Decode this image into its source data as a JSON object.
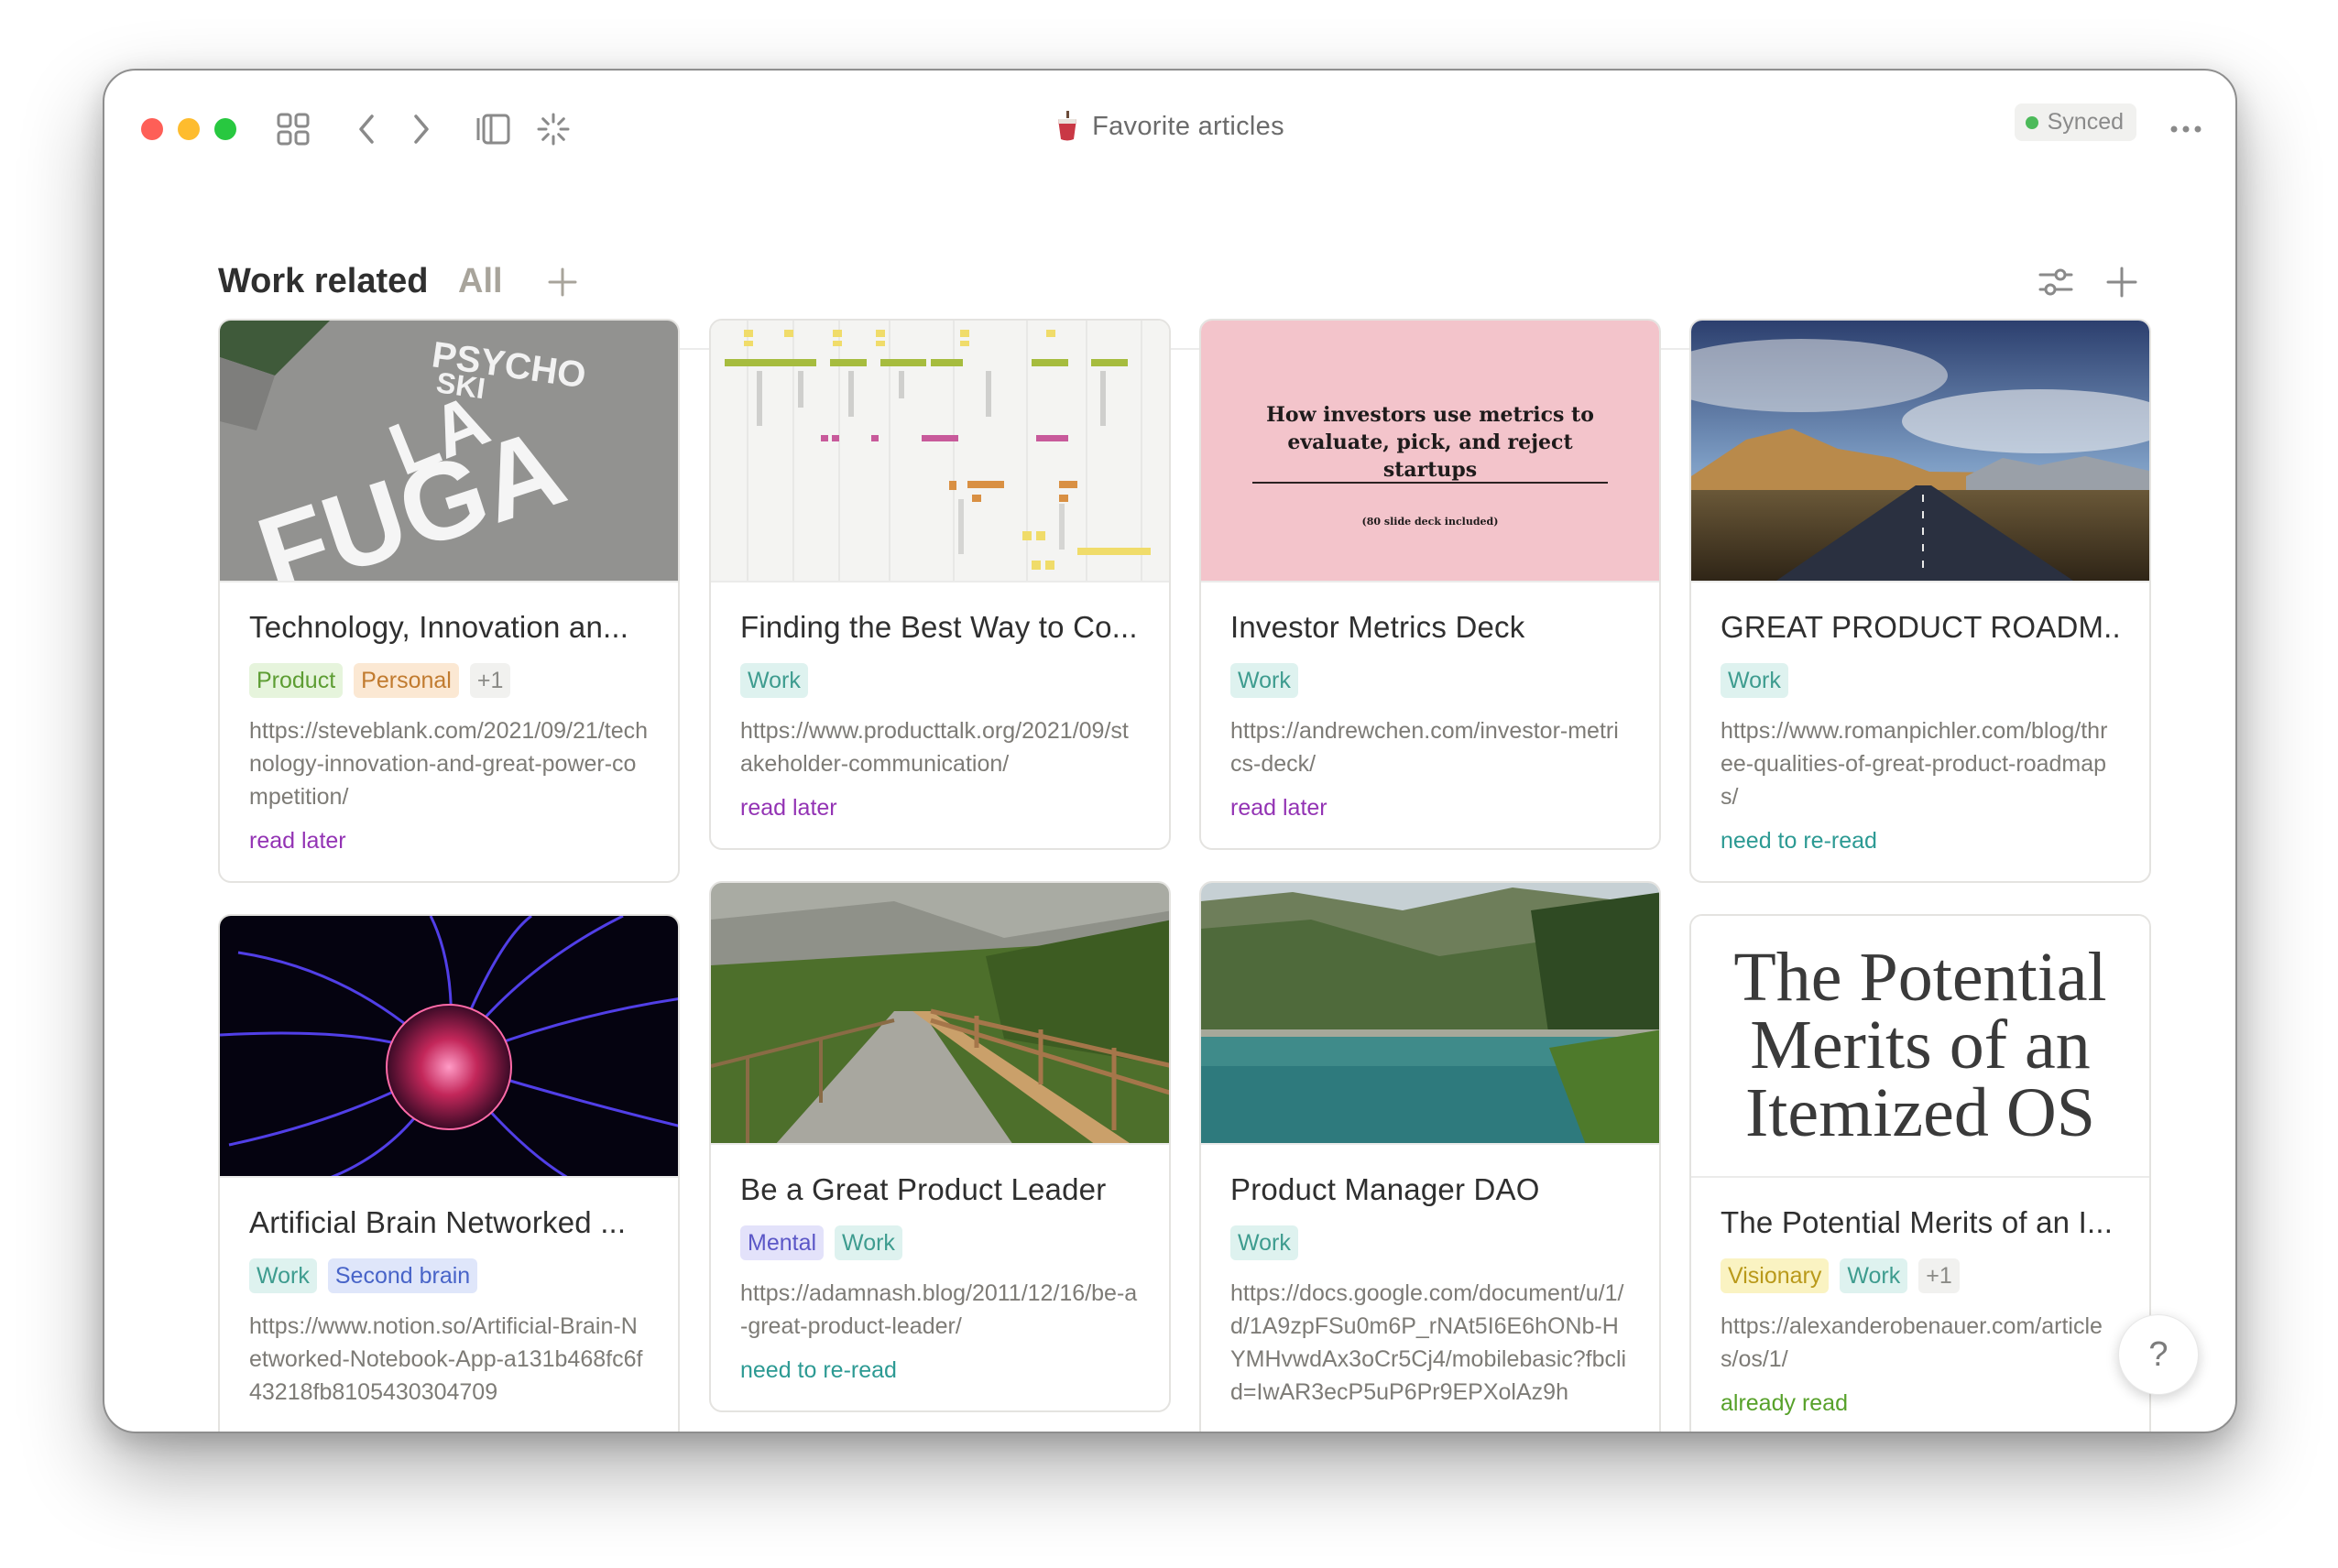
{
  "window": {
    "title": "Favorite articles",
    "sync_status": "Synced"
  },
  "view": {
    "active_tab": "Work related",
    "other_tab": "All"
  },
  "cards": [
    {
      "title": "Technology, Innovation an...",
      "tags": [
        "Product",
        "Personal",
        "+1"
      ],
      "url": "https://steveblank.com/2021/09/21/technology-innovation-and-great-power-competition/",
      "status": "read later",
      "cover_text": [
        "PSYCHO",
        "SKI",
        "LA",
        "FUGA"
      ]
    },
    {
      "title": "Finding the Best Way to Co...",
      "tags": [
        "Work"
      ],
      "url": "https://www.producttalk.org/2021/09/stakeholder-communication/",
      "status": "read later"
    },
    {
      "title": "Investor Metrics Deck",
      "tags": [
        "Work"
      ],
      "url": "https://andrewchen.com/investor-metrics-deck/",
      "status": "read later",
      "cover_heading": "How investors use metrics to evaluate, pick, and reject startups",
      "cover_sub": "(80 slide deck included)"
    },
    {
      "title": "GREAT PRODUCT ROADM...",
      "tags": [
        "Work"
      ],
      "url": "https://www.romanpichler.com/blog/three-qualities-of-great-product-roadmaps/",
      "status": "need to re-read"
    },
    {
      "title": "Artificial Brain Networked ...",
      "tags": [
        "Work",
        "Second brain"
      ],
      "url": "https://www.notion.so/Artificial-Brain-Networked-Notebook-App-a131b468fc6f43218fb8105430304709"
    },
    {
      "title": "Be a Great Product Leader",
      "tags": [
        "Mental",
        "Work"
      ],
      "url": "https://adamnash.blog/2011/12/16/be-a-great-product-leader/",
      "status": "need to re-read"
    },
    {
      "title": "Product Manager DAO",
      "tags": [
        "Work"
      ],
      "url": "https://docs.google.com/document/u/1/d/1A9zpFSu0m6P_rNAt5I6E6hONb-HYMHvwdAx3oCr5Cj4/mobilebasic?fbclid=IwAR3ecP5uP6Pr9EPXolAz9h"
    },
    {
      "title": "The Potential Merits of an I...",
      "tags": [
        "Visionary",
        "Work",
        "+1"
      ],
      "url": "https://alexanderobenauer.com/articles/os/1/",
      "status": "already read",
      "cover_text": [
        "The Potential",
        "Merits of an",
        "Itemized OS"
      ]
    }
  ],
  "help_label": "?"
}
